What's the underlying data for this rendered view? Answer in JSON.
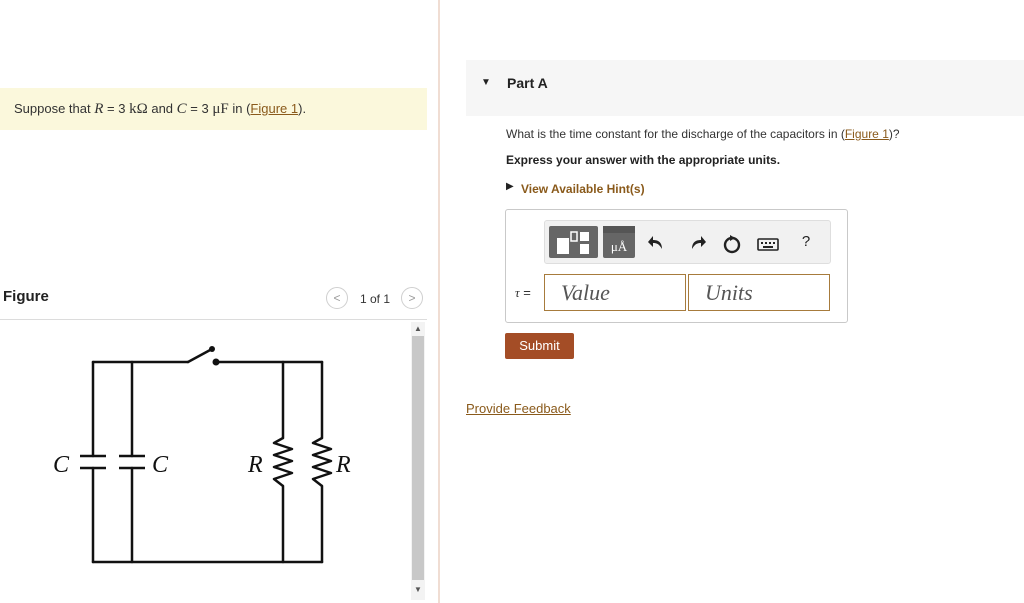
{
  "problem": {
    "text_before": "Suppose that ",
    "r_symbol": "R",
    "r_eq": " = 3 ",
    "r_unit": "kΩ",
    "and": " and ",
    "c_symbol": "C",
    "c_eq": " = 3 ",
    "c_unit": "μF",
    "in_paren": " in (",
    "figure_link": "Figure 1",
    "close_paren": ")."
  },
  "figure": {
    "label": "Figure",
    "pager": "1 of 1",
    "prev_glyph": "<",
    "next_glyph": ">",
    "labels": {
      "c_left": "C",
      "c_right": "C",
      "r_left": "R",
      "r_right": "R"
    }
  },
  "part": {
    "title": "Part A",
    "question_before": "What is the time constant for the discharge of the capacitors in (",
    "question_link": "Figure 1",
    "question_after": ")?",
    "instruction": "Express your answer with the appropriate units.",
    "hint": "View Available Hint(s)"
  },
  "answer": {
    "variable": "τ",
    "equals": " =",
    "value_placeholder": "Value",
    "units_placeholder": "Units",
    "toolbar": {
      "template_icon": "templates-icon",
      "units_icon": "units-icon",
      "units_text": "μÅ",
      "undo_icon": "undo-icon",
      "redo_icon": "redo-icon",
      "reset_icon": "reset-icon",
      "keyboard_icon": "keyboard-icon",
      "help_text": "?"
    }
  },
  "submit_label": "Submit",
  "feedback_label": "Provide Feedback",
  "colors": {
    "accent": "#a44d26",
    "link": "#8a5a1b",
    "problem_bg": "#fbf8dc",
    "toolbar_button": "#666666"
  }
}
